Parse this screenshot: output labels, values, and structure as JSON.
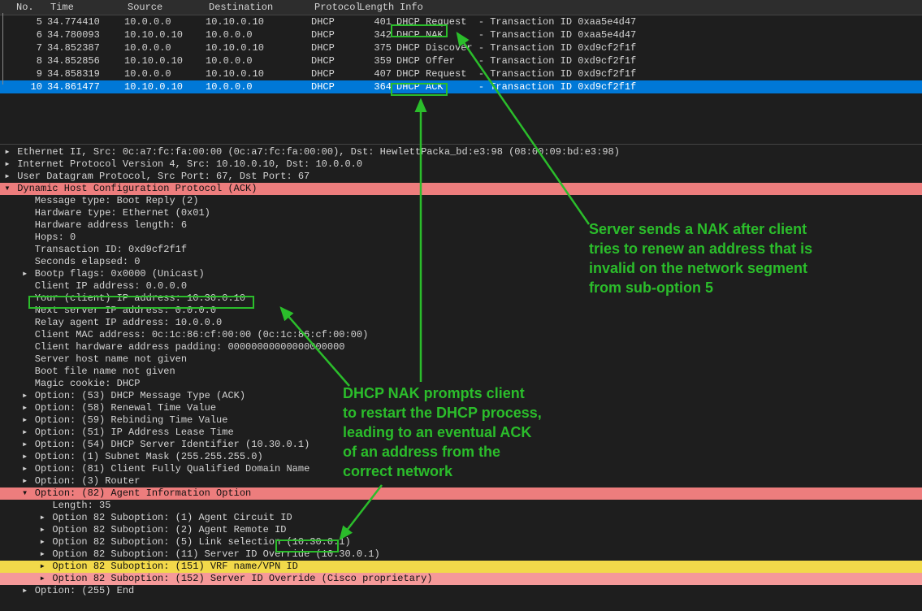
{
  "packet_list": {
    "headers": [
      "No.",
      "Time",
      "Source",
      "Destination",
      "Protocol",
      "Length",
      "Info"
    ],
    "rows": [
      {
        "no": "5",
        "time": "34.774410",
        "src": "10.0.0.0",
        "dst": "10.10.0.10",
        "proto": "DHCP",
        "len": "401",
        "info": "DHCP Request  - Transaction ID 0xaa5e4d47"
      },
      {
        "no": "6",
        "time": "34.780093",
        "src": "10.10.0.10",
        "dst": "10.0.0.0",
        "proto": "DHCP",
        "len": "342",
        "info": "DHCP NAK      - Transaction ID 0xaa5e4d47"
      },
      {
        "no": "7",
        "time": "34.852387",
        "src": "10.0.0.0",
        "dst": "10.10.0.10",
        "proto": "DHCP",
        "len": "375",
        "info": "DHCP Discover - Transaction ID 0xd9cf2f1f"
      },
      {
        "no": "8",
        "time": "34.852856",
        "src": "10.10.0.10",
        "dst": "10.0.0.0",
        "proto": "DHCP",
        "len": "359",
        "info": "DHCP Offer    - Transaction ID 0xd9cf2f1f"
      },
      {
        "no": "9",
        "time": "34.858319",
        "src": "10.0.0.0",
        "dst": "10.10.0.10",
        "proto": "DHCP",
        "len": "407",
        "info": "DHCP Request  - Transaction ID 0xd9cf2f1f"
      },
      {
        "no": "10",
        "time": "34.861477",
        "src": "10.10.0.10",
        "dst": "10.0.0.0",
        "proto": "DHCP",
        "len": "364",
        "info": "DHCP ACK      - Transaction ID 0xd9cf2f1f"
      }
    ],
    "selected_index": 5
  },
  "details": {
    "lines": [
      {
        "indent": 0,
        "arrow": "▸",
        "text": "Ethernet II, Src: 0c:a7:fc:fa:00:00 (0c:a7:fc:fa:00:00), Dst: HewlettPacka_bd:e3:98 (08:00:09:bd:e3:98)",
        "hl": ""
      },
      {
        "indent": 0,
        "arrow": "▸",
        "text": "Internet Protocol Version 4, Src: 10.10.0.10, Dst: 10.0.0.0",
        "hl": ""
      },
      {
        "indent": 0,
        "arrow": "▸",
        "text": "User Datagram Protocol, Src Port: 67, Dst Port: 67",
        "hl": ""
      },
      {
        "indent": 0,
        "arrow": "▾",
        "text": "Dynamic Host Configuration Protocol (ACK)",
        "hl": "red"
      },
      {
        "indent": 1,
        "arrow": "",
        "text": "Message type: Boot Reply (2)",
        "hl": ""
      },
      {
        "indent": 1,
        "arrow": "",
        "text": "Hardware type: Ethernet (0x01)",
        "hl": ""
      },
      {
        "indent": 1,
        "arrow": "",
        "text": "Hardware address length: 6",
        "hl": ""
      },
      {
        "indent": 1,
        "arrow": "",
        "text": "Hops: 0",
        "hl": ""
      },
      {
        "indent": 1,
        "arrow": "",
        "text": "Transaction ID: 0xd9cf2f1f",
        "hl": ""
      },
      {
        "indent": 1,
        "arrow": "",
        "text": "Seconds elapsed: 0",
        "hl": ""
      },
      {
        "indent": 1,
        "arrow": "▸",
        "text": "Bootp flags: 0x0000 (Unicast)",
        "hl": ""
      },
      {
        "indent": 1,
        "arrow": "",
        "text": "Client IP address: 0.0.0.0",
        "hl": ""
      },
      {
        "indent": 1,
        "arrow": "",
        "text": "Your (client) IP address: 10.30.0.10",
        "hl": ""
      },
      {
        "indent": 1,
        "arrow": "",
        "text": "Next server IP address: 0.0.0.0",
        "hl": ""
      },
      {
        "indent": 1,
        "arrow": "",
        "text": "Relay agent IP address: 10.0.0.0",
        "hl": ""
      },
      {
        "indent": 1,
        "arrow": "",
        "text": "Client MAC address: 0c:1c:86:cf:00:00 (0c:1c:86:cf:00:00)",
        "hl": ""
      },
      {
        "indent": 1,
        "arrow": "",
        "text": "Client hardware address padding: 00000000000000000000",
        "hl": ""
      },
      {
        "indent": 1,
        "arrow": "",
        "text": "Server host name not given",
        "hl": ""
      },
      {
        "indent": 1,
        "arrow": "",
        "text": "Boot file name not given",
        "hl": ""
      },
      {
        "indent": 1,
        "arrow": "",
        "text": "Magic cookie: DHCP",
        "hl": ""
      },
      {
        "indent": 1,
        "arrow": "▸",
        "text": "Option: (53) DHCP Message Type (ACK)",
        "hl": ""
      },
      {
        "indent": 1,
        "arrow": "▸",
        "text": "Option: (58) Renewal Time Value",
        "hl": ""
      },
      {
        "indent": 1,
        "arrow": "▸",
        "text": "Option: (59) Rebinding Time Value",
        "hl": ""
      },
      {
        "indent": 1,
        "arrow": "▸",
        "text": "Option: (51) IP Address Lease Time",
        "hl": ""
      },
      {
        "indent": 1,
        "arrow": "▸",
        "text": "Option: (54) DHCP Server Identifier (10.30.0.1)",
        "hl": ""
      },
      {
        "indent": 1,
        "arrow": "▸",
        "text": "Option: (1) Subnet Mask (255.255.255.0)",
        "hl": ""
      },
      {
        "indent": 1,
        "arrow": "▸",
        "text": "Option: (81) Client Fully Qualified Domain Name",
        "hl": ""
      },
      {
        "indent": 1,
        "arrow": "▸",
        "text": "Option: (3) Router",
        "hl": ""
      },
      {
        "indent": 1,
        "arrow": "▾",
        "text": "Option: (82) Agent Information Option",
        "hl": "red"
      },
      {
        "indent": 2,
        "arrow": "",
        "text": "Length: 35",
        "hl": ""
      },
      {
        "indent": 2,
        "arrow": "▸",
        "text": "Option 82 Suboption: (1) Agent Circuit ID",
        "hl": ""
      },
      {
        "indent": 2,
        "arrow": "▸",
        "text": "Option 82 Suboption: (2) Agent Remote ID",
        "hl": ""
      },
      {
        "indent": 2,
        "arrow": "▸",
        "text": "Option 82 Suboption: (5) Link selection (10.30.0.1)",
        "hl": ""
      },
      {
        "indent": 2,
        "arrow": "▸",
        "text": "Option 82 Suboption: (11) Server ID Override (10.30.0.1)",
        "hl": ""
      },
      {
        "indent": 2,
        "arrow": "▸",
        "text": "Option 82 Suboption: (151) VRF name/VPN ID",
        "hl": "yellow"
      },
      {
        "indent": 2,
        "arrow": "▸",
        "text": "Option 82 Suboption: (152) Server ID Override (Cisco proprietary)",
        "hl": "red2"
      },
      {
        "indent": 1,
        "arrow": "▸",
        "text": "Option: (255) End",
        "hl": ""
      }
    ]
  },
  "annotations": {
    "top": "Server sends a NAK after client\ntries to renew an address that is\ninvalid on the network segment\nfrom sub-option 5",
    "bottom": "DHCP NAK prompts client\nto restart the DHCP process,\nleading to an eventual ACK\nof an address from the\ncorrect network"
  }
}
